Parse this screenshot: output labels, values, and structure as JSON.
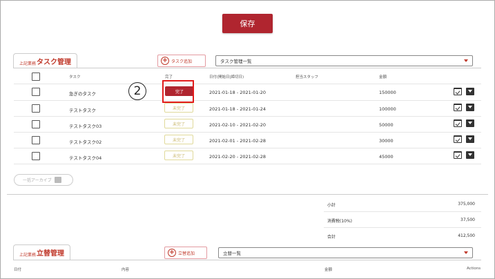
{
  "save_button": "保存",
  "task_section": {
    "tab_prefix": "上記業務",
    "tab_title": "タスク管理",
    "add_button": "タスク追加",
    "select_value": "タスク管理一覧",
    "headers": {
      "task": "タスク",
      "done": "完了",
      "date": "日付(開始日|締切日)",
      "staff": "担当スタッフ",
      "amount": "金額"
    },
    "rows": [
      {
        "task": "急ぎのタスク",
        "status": "完了",
        "status_type": "done",
        "date": "2021-01-18 - 2021-01-20",
        "amount": "150000"
      },
      {
        "task": "テストタスク",
        "status": "未完了",
        "status_type": "undone",
        "date": "2021-01-18 - 2021-01-24",
        "amount": "100000"
      },
      {
        "task": "テストタスク03",
        "status": "未完了",
        "status_type": "undone",
        "date": "2021-02-10 - 2021-02-20",
        "amount": "50000"
      },
      {
        "task": "テストタスク02",
        "status": "未完了",
        "status_type": "undone",
        "date": "2021-02-01 - 2021-02-28",
        "amount": "30000"
      },
      {
        "task": "テストタスク04",
        "status": "未完了",
        "status_type": "undone",
        "date": "2021-02-20 - 2021-02-28",
        "amount": "45000"
      }
    ],
    "archive_button": "一括アーカイブ"
  },
  "annotation_number": "2",
  "summary": {
    "subtotal_label": "小計",
    "subtotal_value": "375,000",
    "tax_label": "消費税(10%)",
    "tax_value": "37,500",
    "total_label": "合計",
    "total_value": "412,500"
  },
  "expense_section": {
    "tab_prefix": "上記業務",
    "tab_title": "立替管理",
    "add_button": "立替追加",
    "select_value": "立替一覧",
    "headers": {
      "date": "日付",
      "content": "内容",
      "amount": "金額",
      "actions": "Actions"
    }
  },
  "colors": {
    "accent": "#b0252f",
    "highlight": "#e21b1b",
    "undone_border": "#e0d99a"
  },
  "icons": [
    "calendar-check-icon",
    "archive-box-icon",
    "plus-circle-icon",
    "caret-down-icon"
  ]
}
